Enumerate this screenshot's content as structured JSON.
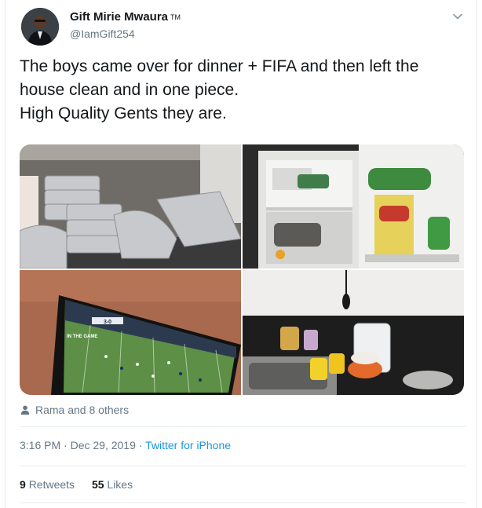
{
  "tweet": {
    "author_name": "Gift Mirie Mwaura",
    "author_badge": "TM",
    "author_handle": "@IamGift254",
    "text_lines": [
      "The boys came over for dinner + FIFA and then left the",
      "house clean and in one piece.",
      "High Quality Gents they are."
    ],
    "media": [
      {
        "icon": "photo-foil-trays"
      },
      {
        "icon": "photo-fridge"
      },
      {
        "icon": "photo-tv-fifa"
      },
      {
        "icon": "photo-kitchen-sink"
      }
    ],
    "tv_overlay": {
      "score": "3-0",
      "banner": "IN THE GAME"
    },
    "liked_by": "Rama and 8 others",
    "time": "3:16 PM",
    "date": "Dec 29, 2019",
    "separator": "·",
    "source": "Twitter for iPhone",
    "retweets_count": "9",
    "retweets_label": "Retweets",
    "likes_count": "55",
    "likes_label": "Likes"
  },
  "colors": {
    "text": "#14171a",
    "muted": "#657786",
    "link": "#1b95e0",
    "border": "#e6ecf0"
  }
}
